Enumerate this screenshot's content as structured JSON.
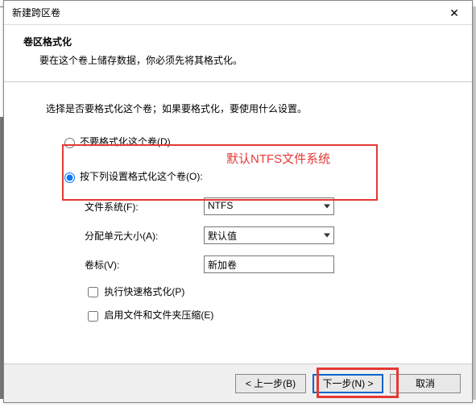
{
  "window": {
    "title": "新建跨区卷",
    "close": "✕"
  },
  "header": {
    "title": "卷区格式化",
    "desc": "要在这个卷上储存数据，你必须先将其格式化。"
  },
  "instruction": "选择是否要格式化这个卷；如果要格式化，要使用什么设置。",
  "radios": {
    "no_format": "不要格式化这个卷(D)",
    "do_format": "按下列设置格式化这个卷(O):"
  },
  "annotation": "默认NTFS文件系统",
  "fields": {
    "fs_label": "文件系统(F):",
    "fs_value": "NTFS",
    "alloc_label": "分配单元大小(A):",
    "alloc_value": "默认值",
    "volume_label_label": "卷标(V):",
    "volume_label_value": "新加卷"
  },
  "checks": {
    "quick_format": "执行快速格式化(P)",
    "compression": "启用文件和文件夹压缩(E)"
  },
  "buttons": {
    "back": "< 上一步(B)",
    "next": "下一步(N) >",
    "cancel": "取消"
  }
}
